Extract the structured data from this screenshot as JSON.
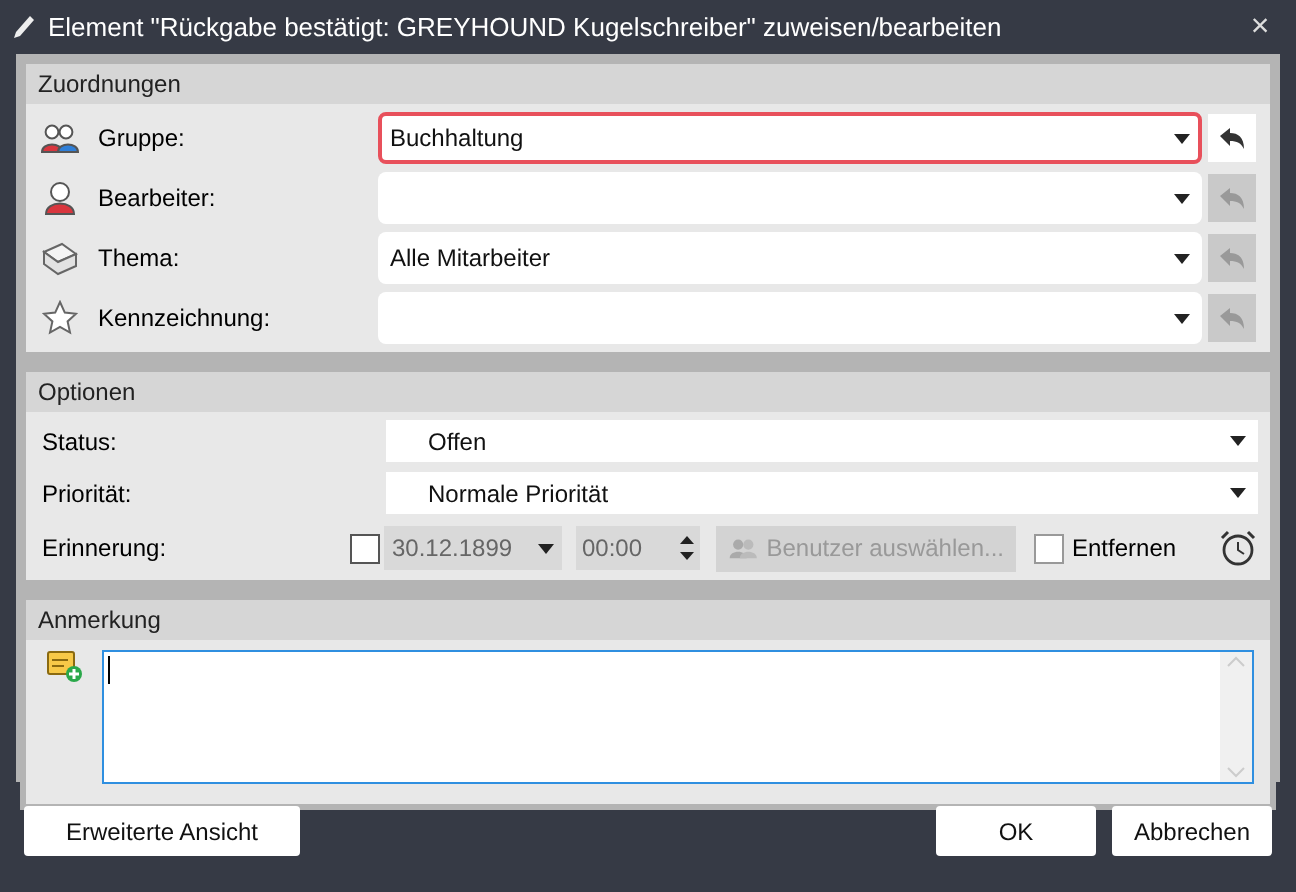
{
  "window": {
    "title": "Element \"Rückgabe bestätigt: GREYHOUND Kugelschreiber\" zuweisen/bearbeiten",
    "close": "×"
  },
  "assignments": {
    "title": "Zuordnungen",
    "rows": [
      {
        "kind": "group",
        "label": "Gruppe:",
        "value": "Buchhaltung",
        "highlighted": true,
        "undo_enabled": true
      },
      {
        "kind": "person",
        "label": "Bearbeiter:",
        "highlighted": false,
        "undo_enabled": false
      },
      {
        "kind": "book",
        "label": "Thema:",
        "value": "Alle Mitarbeiter",
        "highlighted": false,
        "undo_enabled": false
      },
      {
        "kind": "star",
        "label": "Kennzeichnung:",
        "highlighted": false,
        "undo_enabled": false
      }
    ]
  },
  "options": {
    "title": "Optionen",
    "status": {
      "label": "Status:",
      "value": "Offen"
    },
    "priority": {
      "label": "Priorität:",
      "value": "Normale Priorität"
    },
    "reminder": {
      "label": "Erinnerung:",
      "checked": false,
      "date": "30.12.1899",
      "time": "00:00",
      "user_button": {
        "label": "Benutzer auswählen...",
        "disabled": true
      },
      "remove": {
        "label": "Entfernen",
        "checked": false
      }
    }
  },
  "note": {
    "title": "Anmerkung"
  },
  "buttons": [
    {
      "kind": "left",
      "label": "Erweiterte Ansicht"
    },
    {
      "kind": "right",
      "label": "OK"
    },
    {
      "kind": "right",
      "label": "Abbrechen"
    }
  ]
}
